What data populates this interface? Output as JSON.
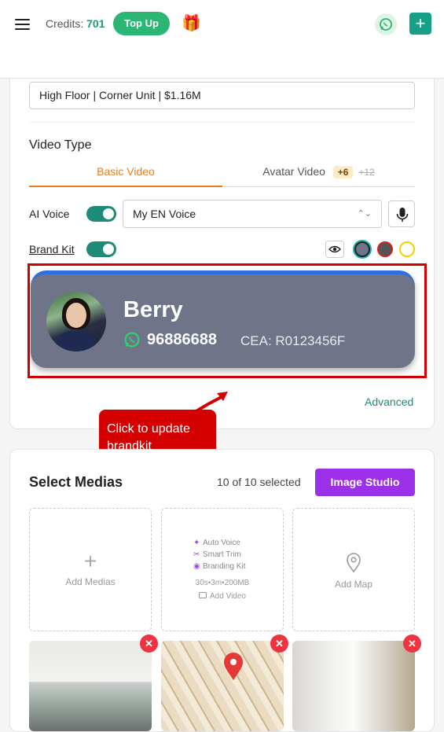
{
  "header": {
    "credits_label": "Credits:",
    "credits_value": "701",
    "topup_label": "Top Up",
    "gift_icon": "🎁",
    "add_icon": "+"
  },
  "form": {
    "title_value": "High Floor | Corner Unit | $1.16M",
    "video_type_label": "Video Type",
    "tabs": {
      "basic_label": "Basic Video",
      "avatar_label": "Avatar Video",
      "avatar_badge": "+6",
      "avatar_old_cost": "+12"
    },
    "ai_voice_label": "AI Voice",
    "ai_voice_on": true,
    "voice_value": "My EN Voice",
    "brand_kit_label": "Brand Kit",
    "brand_kit_on": true,
    "swatch_colors": [
      "#6f7488",
      "#555555",
      "#ffffff"
    ],
    "advanced_label": "Advanced"
  },
  "brand_card": {
    "name": "Berry",
    "phone": "96886688",
    "cea": "CEA: R0123456F",
    "bg_color": "#6f7488",
    "accent_color": "#2d6fe0"
  },
  "annotation": {
    "callout_text": "Click to update brandkit"
  },
  "medias": {
    "title": "Select Medias",
    "selected_count": "10 of 10 selected",
    "image_studio_label": "Image Studio",
    "add_medias_label": "Add Medias",
    "add_video": {
      "features": [
        "Auto Voice",
        "Smart Trim",
        "Branding Kit"
      ],
      "limits": "30s•3m•200MB",
      "label": "Add Video"
    },
    "add_map_label": "Add Map",
    "remove_icon": "✕"
  }
}
